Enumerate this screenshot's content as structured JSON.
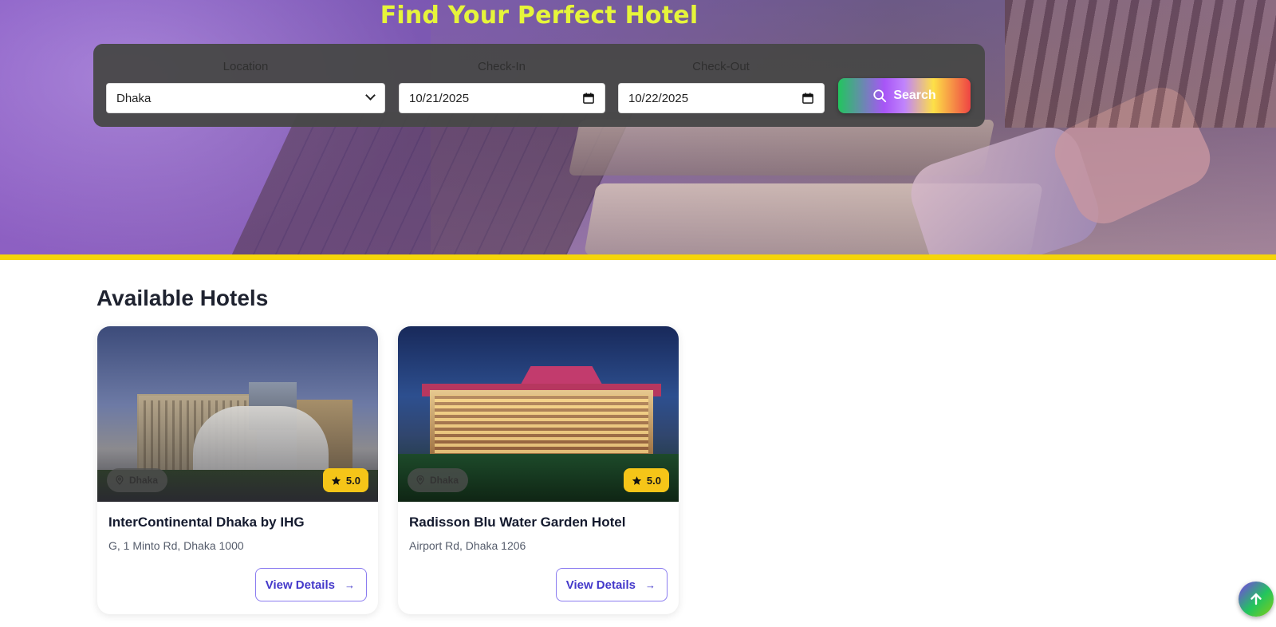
{
  "hero": {
    "title": "Find Your Perfect Hotel"
  },
  "search": {
    "location_label": "Location",
    "checkin_label": "Check-In",
    "checkout_label": "Check-Out",
    "location_value": "Dhaka",
    "checkin_value": "10/21/2025",
    "checkout_value": "10/22/2025",
    "button_label": "Search"
  },
  "main": {
    "section_title": "Available Hotels",
    "hotels": [
      {
        "name": "InterContinental Dhaka by IHG",
        "address": "G, 1 Minto Rd, Dhaka 1000",
        "city": "Dhaka",
        "rating": "5.0",
        "cta": "View Details"
      },
      {
        "name": "Radisson Blu Water Garden Hotel",
        "address": "Airport Rd, Dhaka 1206",
        "city": "Dhaka",
        "rating": "5.0",
        "cta": "View Details"
      }
    ]
  },
  "colors": {
    "title_yellow": "#e6f53a",
    "accent_yellow": "#f5d50a",
    "button_indigo": "#4338ca"
  },
  "icons": {
    "search": "search-icon",
    "location": "map-pin-icon",
    "rating": "star-icon",
    "arrow": "arrow-right-icon",
    "back_to_top": "arrow-up-icon",
    "calendar": "calendar-icon",
    "dropdown": "chevron-down-icon"
  }
}
